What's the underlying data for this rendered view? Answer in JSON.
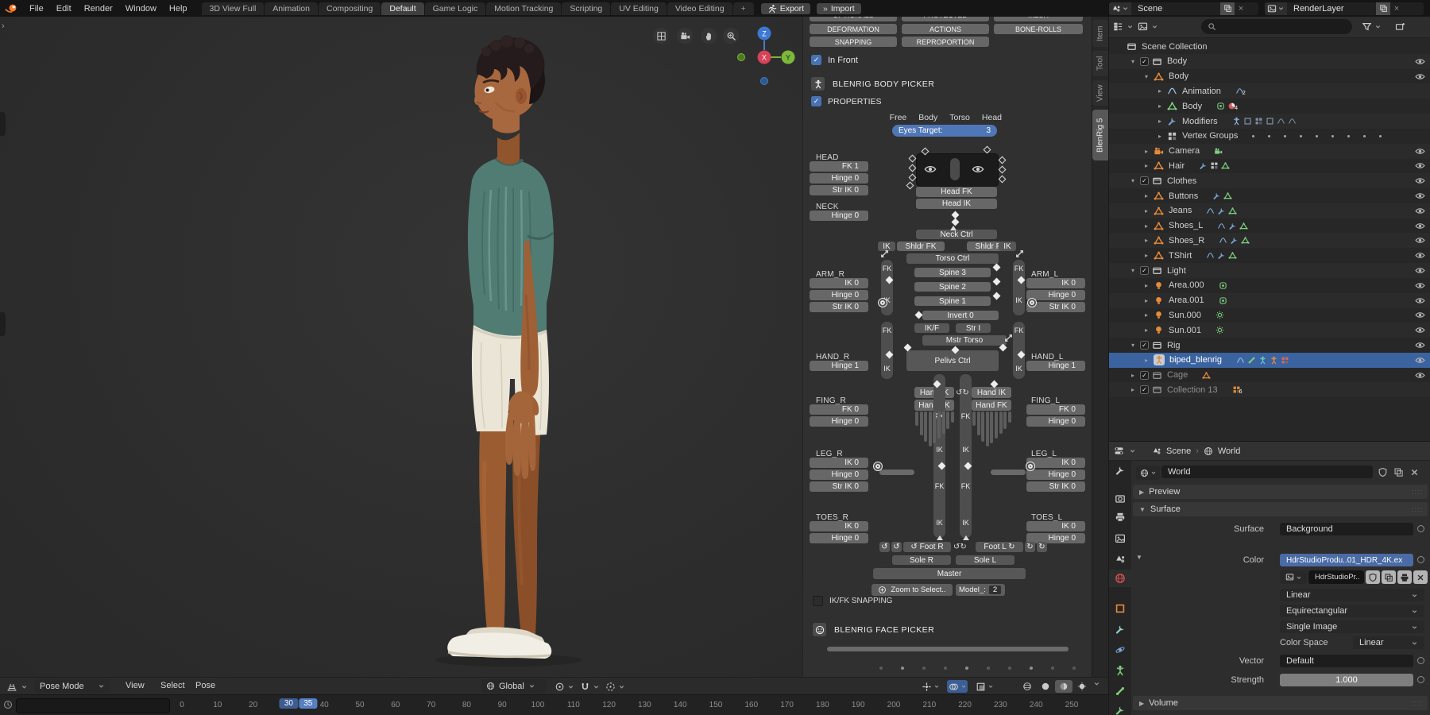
{
  "colors": {
    "accent": "#4772b3",
    "selection_row": "#3a63a0",
    "slider_blue": "#4f77b7",
    "value_blue": "#4a6ba6",
    "chip_frame": "#5680c2",
    "chip_range": "#3d5c91",
    "object_orange": "#e58b3a",
    "data_green": "#7fd07f",
    "icon_blue": "#85b3e0"
  },
  "topbar": {
    "menus": [
      "File",
      "Edit",
      "Render",
      "Window",
      "Help"
    ],
    "workspaces": [
      "3D View Full",
      "Animation",
      "Compositing",
      "Default",
      "Game Logic",
      "Motion Tracking",
      "Scripting",
      "UV Editing",
      "Video Editing"
    ],
    "active_workspace": "Default",
    "new_workspace_button": "+",
    "export_label": "Export",
    "import_label": "Import",
    "scene_selector": "Scene",
    "render_layer_selector": "RenderLayer"
  },
  "viewport": {
    "header": {
      "mode": "Pose Mode",
      "menus": [
        "View",
        "Select",
        "Pose"
      ],
      "orientation": "Global",
      "toggles": [
        "gizmos",
        "overlays",
        "xray"
      ],
      "active_toggle": "overlays",
      "shading_modes": [
        "wireframe",
        "solid",
        "material",
        "rendered"
      ],
      "active_shading": "material"
    },
    "axis_gizmo": {
      "x": "X",
      "y": "Y",
      "z": "Z"
    },
    "corner_tools": [
      "grid",
      "camera",
      "pan-hand",
      "zoom"
    ]
  },
  "picker": {
    "sidebar_tabs": [
      "Item",
      "Tool",
      "View",
      "BlenRig 5"
    ],
    "active_tab": "BlenRig 5",
    "partial_buttons": [
      "OPTIONALS",
      "PROTECTED",
      "MESH"
    ],
    "button_rows": [
      [
        "DEFORMATION",
        "ACTIONS",
        "BONE-ROLLS"
      ],
      [
        "SNAPPING",
        "REPROPORTION"
      ]
    ],
    "in_front_label": "In Front",
    "in_front_checked": true,
    "title": "BLENRIG BODY PICKER",
    "properties_label": "PROPERTIES",
    "properties_checked": true,
    "pose_filters": [
      "Free",
      "Body",
      "Torso",
      "Head"
    ],
    "eyes_target_label": "Eyes Target:",
    "eyes_target_value": "3",
    "left_sections": [
      {
        "label": "HEAD",
        "buttons": [
          "FK 1",
          "Hinge 0",
          "Str IK 0"
        ]
      },
      {
        "label": "NECK",
        "buttons": [
          "Hinge 0"
        ]
      },
      {
        "label": "ARM_R",
        "buttons": [
          "IK 0",
          "Hinge 0",
          "Str IK 0"
        ]
      },
      {
        "label": "HAND_R",
        "buttons": [
          "Hinge 1"
        ]
      },
      {
        "label": "FING_R",
        "buttons": [
          "FK 0",
          "Hinge 0"
        ]
      },
      {
        "label": "LEG_R",
        "buttons": [
          "IK 0",
          "Hinge 0",
          "Str IK 0"
        ]
      },
      {
        "label": "TOES_R",
        "buttons": [
          "IK 0",
          "Hinge 0"
        ]
      }
    ],
    "right_sections": [
      {
        "label": "ARM_L",
        "buttons": [
          "IK 0",
          "Hinge 0",
          "Str IK 0"
        ]
      },
      {
        "label": "HAND_L",
        "buttons": [
          "Hinge 1"
        ]
      },
      {
        "label": "FING_L",
        "buttons": [
          "FK 0",
          "Hinge 0"
        ]
      },
      {
        "label": "LEG_L",
        "buttons": [
          "IK 0",
          "Hinge 0",
          "Str IK 0"
        ]
      },
      {
        "label": "TOES_L",
        "buttons": [
          "IK 0",
          "Hinge 0"
        ]
      }
    ],
    "center": {
      "head_fk": "Head FK",
      "head_ik": "Head IK",
      "neck": "Neck Ctrl",
      "shoulder_ik_left": "IK",
      "shoulder_fk_left": "Shldr FK",
      "shoulder_fk_right": "Shldr FK",
      "shoulder_ik_right": "IK",
      "torso": "Torso Ctrl",
      "spines": [
        "Spine 3",
        "Spine 2",
        "Spine 1"
      ],
      "invert": "Invert 0",
      "ik_f": "IK/F",
      "str_i": "Str I",
      "master_torso": "Mstr Torso",
      "pelvis": "Pelivs Ctrl",
      "hand_ik": "Hand IK",
      "hand_fk": "Hand FK",
      "fk": "FK",
      "ik": "IK",
      "foot_right": "Foot R",
      "foot_left": "Foot L",
      "sole_right": "Sole R",
      "sole_left": "Sole L",
      "master": "Master",
      "zoom_button": "Zoom to Select..",
      "model_label": "Model_:",
      "model_value": "2",
      "ikfk_snapping_label": "IK/FK SNAPPING",
      "ikfk_snapping_checked": false,
      "face_picker_title": "BLENRIG FACE PICKER"
    }
  },
  "outliner": {
    "search_placeholder": "",
    "rows": [
      {
        "label": "Scene Collection",
        "level": 0,
        "icon": "collection",
        "expand": "none",
        "eye": false
      },
      {
        "label": "Body",
        "level": 1,
        "icon": "collection",
        "checkbox": true,
        "expand": "open",
        "eye": true
      },
      {
        "label": "Body",
        "level": 2,
        "icon": "mesh-object",
        "expand": "open",
        "eye": true
      },
      {
        "label": "Animation",
        "level": 3,
        "icon": "action",
        "expand": "closed",
        "eye": false,
        "trail": [
          {
            "icon": "action",
            "color": "#85b3e0",
            "badge": "2"
          }
        ]
      },
      {
        "label": "Body",
        "level": 3,
        "icon": "mesh-data",
        "expand": "closed",
        "eye": false,
        "trail": [
          {
            "icon": "material",
            "color": "#7fd07f"
          },
          {
            "icon": "pie",
            "color": "#d05c5c",
            "badge": "4"
          }
        ]
      },
      {
        "label": "Modifiers",
        "level": 3,
        "icon": "wrench",
        "expand": "closed",
        "eye": false,
        "trail": [
          {
            "icon": "person",
            "color": "#85b3e0"
          },
          {
            "icon": "square",
            "color": "#7d8ea3"
          },
          {
            "icon": "vgroup",
            "color": "#7d8ea3"
          },
          {
            "icon": "square",
            "color": "#7d8ea3"
          },
          {
            "icon": "action",
            "color": "#7d8ea3"
          },
          {
            "icon": "action",
            "color": "#7d8ea3"
          }
        ]
      },
      {
        "label": "Vertex Groups",
        "level": 3,
        "icon": "vgroup",
        "expand": "closed",
        "eye": false,
        "dots": 9
      },
      {
        "label": "Camera",
        "level": 2,
        "icon": "camera-object",
        "expand": "closed",
        "eye": true,
        "trail": [
          {
            "icon": "camera-data",
            "color": "#7fd07f"
          }
        ]
      },
      {
        "label": "Hair",
        "level": 2,
        "icon": "mesh-object",
        "expand": "closed",
        "eye": true,
        "trail": [
          {
            "icon": "wrench",
            "color": "#7aa5d8"
          },
          {
            "icon": "vgroup",
            "color": "#c0c0c0"
          },
          {
            "icon": "mesh-data",
            "color": "#7fd07f"
          }
        ]
      },
      {
        "label": "Clothes",
        "level": 1,
        "icon": "collection",
        "checkbox": true,
        "expand": "open",
        "eye": true
      },
      {
        "label": "Buttons",
        "level": 2,
        "icon": "mesh-object",
        "expand": "closed",
        "eye": true,
        "trail": [
          {
            "icon": "wrench",
            "color": "#7aa5d8"
          },
          {
            "icon": "mesh-data",
            "color": "#7fd07f"
          }
        ]
      },
      {
        "label": "Jeans",
        "level": 2,
        "icon": "mesh-object",
        "expand": "closed",
        "eye": true,
        "trail": [
          {
            "icon": "action",
            "color": "#85b3e0"
          },
          {
            "icon": "wrench",
            "color": "#7aa5d8"
          },
          {
            "icon": "mesh-data",
            "color": "#7fd07f"
          }
        ]
      },
      {
        "label": "Shoes_L",
        "level": 2,
        "icon": "mesh-object",
        "expand": "closed",
        "eye": true,
        "trail": [
          {
            "icon": "action",
            "color": "#85b3e0"
          },
          {
            "icon": "wrench",
            "color": "#7aa5d8"
          },
          {
            "icon": "mesh-data",
            "color": "#7fd07f"
          }
        ]
      },
      {
        "label": "Shoes_R",
        "level": 2,
        "icon": "mesh-object",
        "expand": "closed",
        "eye": true,
        "trail": [
          {
            "icon": "action",
            "color": "#85b3e0"
          },
          {
            "icon": "wrench",
            "color": "#7aa5d8"
          },
          {
            "icon": "mesh-data",
            "color": "#7fd07f"
          }
        ]
      },
      {
        "label": "TShirt",
        "level": 2,
        "icon": "mesh-object",
        "expand": "closed",
        "eye": true,
        "trail": [
          {
            "icon": "action",
            "color": "#85b3e0"
          },
          {
            "icon": "wrench",
            "color": "#7aa5d8"
          },
          {
            "icon": "mesh-data",
            "color": "#7fd07f"
          }
        ]
      },
      {
        "label": "Light",
        "level": 1,
        "icon": "collection",
        "checkbox": true,
        "expand": "open",
        "eye": true
      },
      {
        "label": "Area.000",
        "level": 2,
        "icon": "light-object",
        "expand": "closed",
        "eye": true,
        "trail": [
          {
            "icon": "light-area",
            "color": "#7fd07f"
          }
        ]
      },
      {
        "label": "Area.001",
        "level": 2,
        "icon": "light-object",
        "expand": "closed",
        "eye": true,
        "trail": [
          {
            "icon": "light-area",
            "color": "#7fd07f"
          }
        ]
      },
      {
        "label": "Sun.000",
        "level": 2,
        "icon": "light-object",
        "expand": "closed",
        "eye": true,
        "trail": [
          {
            "icon": "sun",
            "color": "#7fd07f"
          }
        ]
      },
      {
        "label": "Sun.001",
        "level": 2,
        "icon": "light-object",
        "expand": "closed",
        "eye": true,
        "trail": [
          {
            "icon": "sun",
            "color": "#7fd07f"
          }
        ]
      },
      {
        "label": "Rig",
        "level": 1,
        "icon": "collection",
        "checkbox": true,
        "expand": "open",
        "eye": true
      },
      {
        "label": "biped_blenrig",
        "level": 2,
        "icon": "armature-object",
        "expand": "closed",
        "eye": true,
        "selected": true,
        "active_icon": true,
        "trail": [
          {
            "icon": "action",
            "color": "#9fc3e8"
          },
          {
            "icon": "bone",
            "color": "#7fd07f"
          },
          {
            "icon": "person",
            "color": "#6cc5c0"
          },
          {
            "icon": "person",
            "color": "#e58b3a"
          },
          {
            "icon": "vgroup",
            "color": "#d06a5a"
          }
        ]
      },
      {
        "label": "Cage",
        "level": 1,
        "icon": "collection",
        "checkbox": true,
        "expand": "closed",
        "eye": true,
        "dim": true,
        "trail": [
          {
            "icon": "mesh-object",
            "color": "#e58b3a"
          }
        ]
      },
      {
        "label": "Collection 13",
        "level": 1,
        "icon": "collection",
        "checkbox": true,
        "expand": "closed",
        "eye": false,
        "dim": true,
        "trail": [
          {
            "icon": "vgroup",
            "color": "#e58b3a",
            "badge": "6"
          }
        ]
      }
    ]
  },
  "properties": {
    "breadcrumb": {
      "scene": "Scene",
      "world": "World"
    },
    "tabs": [
      "tool",
      "render",
      "output",
      "view-layer",
      "scene",
      "world",
      "object",
      "constraints",
      "physics",
      "object-data",
      "bone",
      "bone-constraints"
    ],
    "active_tab": "world",
    "world_name": "World",
    "panel_preview": "Preview",
    "panel_surface": "Surface",
    "panel_volume": "Volume",
    "surface_label": "Surface",
    "surface_value": "Background",
    "color_label": "Color",
    "color_value": "HdrStudioProdu..01_HDR_4K.ex",
    "image_name": "HdrStudioPr..",
    "interpolation": "Linear",
    "projection": "Equirectangular",
    "source": "Single Image",
    "color_space_label": "Color Space",
    "color_space_value": "Linear",
    "vector_label": "Vector",
    "vector_value": "Default",
    "strength_label": "Strength",
    "strength_value": "1.000"
  },
  "timeline": {
    "start": 0,
    "end": 250,
    "step": 10,
    "range_frame": 30,
    "current_frame": 35
  }
}
